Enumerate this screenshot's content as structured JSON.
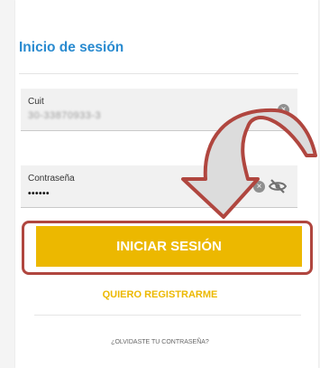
{
  "login": {
    "title": "Inicio de sesión",
    "cuit_label": "Cuit",
    "cuit_value": "30-33870933-3",
    "password_label": "Contraseña",
    "password_value": "••••••",
    "submit_label": "INICIAR SESIÓN",
    "register_label": "QUIERO REGISTRARME",
    "forgot_label": "¿OLVIDASTE TU CONTRASEÑA?"
  },
  "icons": {
    "clear": "clear-icon",
    "visibility": "eye-off-icon",
    "annotation": "curved-arrow-icon"
  },
  "colors": {
    "title": "#2a8bd0",
    "primary_button": "#ecb800",
    "link": "#ecb800",
    "highlight_frame": "#b0463f",
    "arrow_fill": "#dcdcdc"
  }
}
